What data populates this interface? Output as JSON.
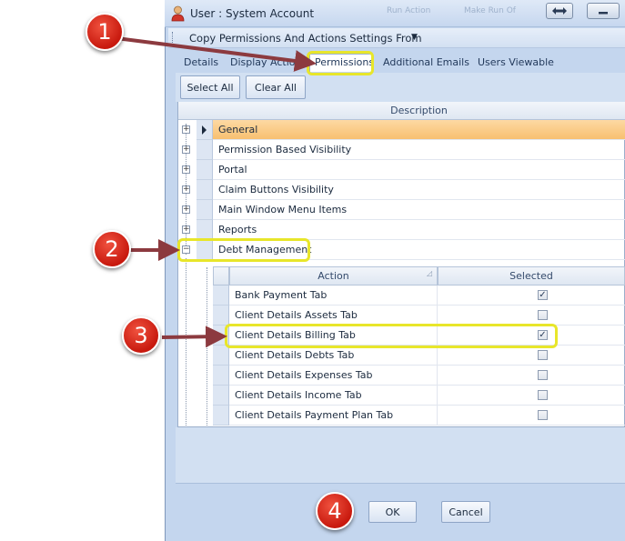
{
  "window": {
    "title": "User : System Account",
    "blurred_items": [
      "Run Action",
      "Make Run Of"
    ]
  },
  "menu": {
    "copy_label": "Copy Permissions And Actions Settings From"
  },
  "tabs": [
    "Details",
    "Display Actio",
    "Permissions",
    "Additional Emails",
    "Users Viewable"
  ],
  "toolbar": {
    "select_all": "Select All",
    "clear_all": "Clear All"
  },
  "grid": {
    "header": "Description",
    "groups": [
      {
        "label": "General",
        "expander": "+"
      },
      {
        "label": "Permission Based Visibility",
        "expander": "+"
      },
      {
        "label": "Portal",
        "expander": "+"
      },
      {
        "label": "Claim Buttons Visibility",
        "expander": "+"
      },
      {
        "label": "Main Window Menu Items",
        "expander": "+"
      },
      {
        "label": "Reports",
        "expander": "+"
      },
      {
        "label": "Debt Management",
        "expander": "−"
      }
    ],
    "sub_grid": {
      "action_header": "Action",
      "selected_header": "Selected",
      "rows": [
        {
          "action": "Bank Payment Tab",
          "mark": "✓"
        },
        {
          "action": "Client Details Assets Tab",
          "mark": ""
        },
        {
          "action": "Client Details Billing Tab",
          "mark": "✓"
        },
        {
          "action": "Client Details Debts Tab",
          "mark": ""
        },
        {
          "action": "Client Details Expenses Tab",
          "mark": ""
        },
        {
          "action": "Client Details Income Tab",
          "mark": ""
        },
        {
          "action": "Client Details Payment Plan Tab",
          "mark": ""
        }
      ]
    }
  },
  "footer": {
    "ok": "OK",
    "cancel": "Cancel"
  },
  "annotations": [
    "1",
    "2",
    "3",
    "4"
  ],
  "colors": {
    "callout": "#e8e62a",
    "badge": "#d42a1c",
    "arrow": "#8c3a3f",
    "selected_row": "#f8c070"
  }
}
